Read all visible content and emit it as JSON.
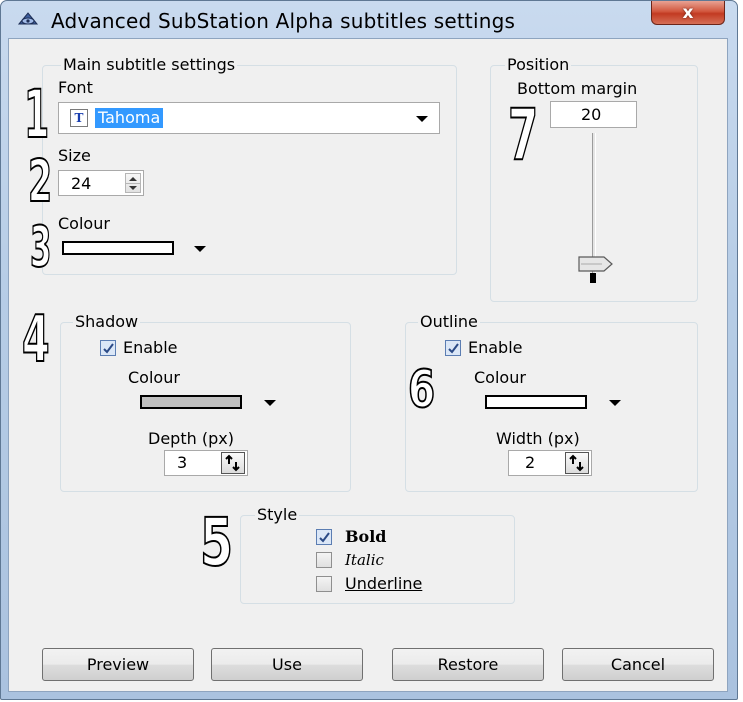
{
  "window": {
    "title": "Advanced SubStation Alpha subtitles settings",
    "close_label": "x"
  },
  "main": {
    "legend": "Main subtitle settings",
    "font_label": "Font",
    "font_value": "Tahoma",
    "size_label": "Size",
    "size_value": "24",
    "colour_label": "Colour",
    "colour_value": "#ffffff"
  },
  "position": {
    "legend": "Position",
    "bottom_margin_label": "Bottom margin",
    "bottom_margin_value": "20"
  },
  "shadow": {
    "legend": "Shadow",
    "enable_label": "Enable",
    "enable_checked": true,
    "colour_label": "Colour",
    "colour_value": "#c0c0c0",
    "depth_label": "Depth (px)",
    "depth_value": "3"
  },
  "outline": {
    "legend": "Outline",
    "enable_label": "Enable",
    "enable_checked": true,
    "colour_label": "Colour",
    "colour_value": "#ffffff",
    "width_label": "Width (px)",
    "width_value": "2"
  },
  "style": {
    "legend": "Style",
    "bold_label": "Bold",
    "bold_checked": true,
    "italic_label": "Italic",
    "italic_checked": false,
    "underline_label": "Underline",
    "underline_checked": false
  },
  "buttons": {
    "preview": "Preview",
    "use": "Use",
    "restore": "Restore",
    "cancel": "Cancel"
  },
  "annotations": [
    "1",
    "2",
    "3",
    "4",
    "5",
    "6",
    "7"
  ]
}
